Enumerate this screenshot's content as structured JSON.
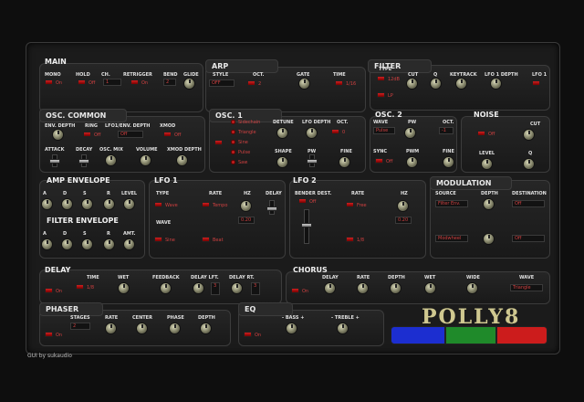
{
  "main": {
    "title": "MAIN",
    "mono": "MONO",
    "hold": "HOLD",
    "ch": "CH.",
    "retrigger": "RETRIGGER",
    "bend": "BEND",
    "glide": "GLIDE",
    "mono_val": "On",
    "hold_val": "Off",
    "ch_val": "1",
    "retrigger_val": "On",
    "bend_val": "2"
  },
  "arp": {
    "title": "ARP",
    "style": "STYLE",
    "oct": "OCT.",
    "gate": "GATE",
    "time": "TIME",
    "style_val": "OFF",
    "oct_val": "2",
    "time_val": "1/16"
  },
  "filter": {
    "title": "FILTER",
    "type": "TYPE",
    "cut": "CUT",
    "q": "Q",
    "keytrack": "KEYTRACK",
    "lfo1depth": "LFO 1 DEPTH",
    "lfo1": "LFO 1",
    "type_val": "12dB",
    "type_val2": "LP"
  },
  "osc_common": {
    "title": "OSC. COMMON",
    "env_depth": "ENV. DEPTH",
    "ring": "RING",
    "lfo_env_depth": "LFO1/ENV. DEPTH",
    "xmod": "XMOD",
    "attack": "ATTACK",
    "decay": "DECAY",
    "osc_mix": "OSC. MIX",
    "volume": "VOLUME",
    "xmod_depth": "XMOD DEPTH",
    "ring_val": "Off",
    "xmod_val": "Off",
    "lfo_val": "Off"
  },
  "osc1": {
    "title": "OSC. 1",
    "waves": [
      "Sidechain",
      "Triangle",
      "Sine",
      "Pulse",
      "Saw"
    ],
    "detune": "DETUNE",
    "lfo_depth": "LFO DEPTH",
    "oct": "OCT.",
    "shape": "SHAPE",
    "pw": "PW",
    "fine": "FINE",
    "oct_val": "0"
  },
  "osc2": {
    "title": "OSC. 2",
    "wave": "WAVE",
    "pw": "PW",
    "oct": "OCT.",
    "sync": "SYNC",
    "pwm": "PWM",
    "fine": "FINE",
    "wave_val": "Pulse",
    "oct_val": "-1",
    "sync_val": "Off"
  },
  "noise": {
    "title": "NOISE",
    "cut": "CUT",
    "level": "LEVEL",
    "q": "Q",
    "val": "Off"
  },
  "amp_env": {
    "title": "AMP ENVELOPE",
    "a": "A",
    "d": "D",
    "s": "S",
    "r": "R",
    "level": "LEVEL"
  },
  "filter_env": {
    "title": "FILTER ENVELOPE",
    "a": "A",
    "d": "D",
    "s": "S",
    "r": "R",
    "amt": "AMT."
  },
  "lfo1": {
    "title": "LFO 1",
    "type": "TYPE",
    "rate": "RATE",
    "hz": "HZ",
    "delay": "DELAY",
    "wave": "WAVE",
    "type_val": "Wave",
    "rate_val": "Tempo",
    "wave_val": "Sine",
    "sync_val": "Beat",
    "hz_val": "0.20"
  },
  "lfo2": {
    "title": "LFO 2",
    "bender": "BENDER DEST.",
    "rate": "RATE",
    "hz": "HZ",
    "bender_val": "Off",
    "rate_val": "Free",
    "sync_val": "1/8",
    "hz_val": "0.20"
  },
  "modulation": {
    "title": "MODULATION",
    "source": "SOURCE",
    "depth": "DEPTH",
    "destination": "DESTINATION",
    "src1": "Filter Env.",
    "dst1": "Off",
    "src2": "Modwheel",
    "dst2": "Off"
  },
  "delay": {
    "title": "DELAY",
    "time": "TIME",
    "wet": "WET",
    "feedback": "FEEDBACK",
    "delay_lft": "DELAY LFT.",
    "delay_rt": "DELAY RT.",
    "val": "On",
    "time_val": "1/8",
    "lft_val": "3",
    "rt_val": "3"
  },
  "chorus": {
    "title": "CHORUS",
    "delay": "DELAY",
    "rate": "RATE",
    "depth": "DEPTH",
    "wet": "WET",
    "wide": "WIDE",
    "wave": "WAVE",
    "val": "On",
    "wave_val": "Triangle"
  },
  "phaser": {
    "title": "PHASER",
    "stages": "STAGES",
    "rate": "RATE",
    "center": "CENTER",
    "phase": "PHASE",
    "depth": "DEPTH",
    "val": "On",
    "stages_val": "2"
  },
  "eq": {
    "title": "EQ",
    "bass": "- BASS +",
    "treble": "- TREBLE +",
    "val": "On"
  },
  "logo": "POLLY8",
  "credit": "GUI by sukaudio",
  "colors": {
    "blue": "#1c2ed0",
    "green": "#1f8a2a",
    "red": "#cc1c1c",
    "accent": "#d04040"
  }
}
